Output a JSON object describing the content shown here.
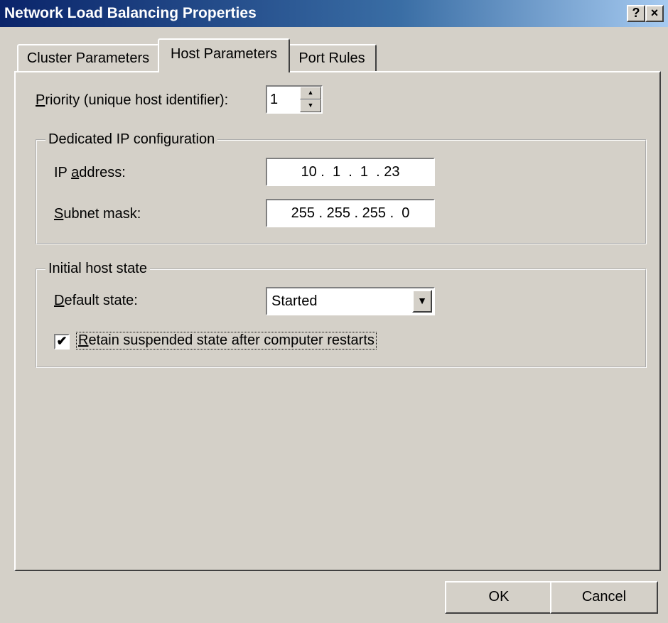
{
  "window": {
    "title": "Network Load Balancing Properties",
    "help_glyph": "?",
    "close_glyph": "×"
  },
  "tabs": [
    {
      "label": "Cluster Parameters"
    },
    {
      "label": "Host Parameters"
    },
    {
      "label": "Port Rules"
    }
  ],
  "priority": {
    "label_accel": "P",
    "label_rest": "riority (unique host identifier):",
    "value": "1",
    "up_glyph": "▲",
    "down_glyph": "▼"
  },
  "dedicated_ip": {
    "legend": "Dedicated IP configuration",
    "ip_label_pre": "IP ",
    "ip_label_accel": "a",
    "ip_label_rest": "ddress:",
    "ip_value": "10 .  1  .  1  . 23",
    "mask_label_accel": "S",
    "mask_label_rest": "ubnet mask:",
    "mask_value": "255 . 255 . 255 .  0"
  },
  "initial_state": {
    "legend": "Initial host state",
    "default_label_accel": "D",
    "default_label_rest": "efault state:",
    "default_value": "Started",
    "dropdown_glyph": "▼",
    "retain_checked": true,
    "check_glyph": "✔",
    "retain_label_accel": "R",
    "retain_label_rest": "etain suspended state after computer restarts"
  },
  "buttons": {
    "ok": "OK",
    "cancel": "Cancel"
  }
}
